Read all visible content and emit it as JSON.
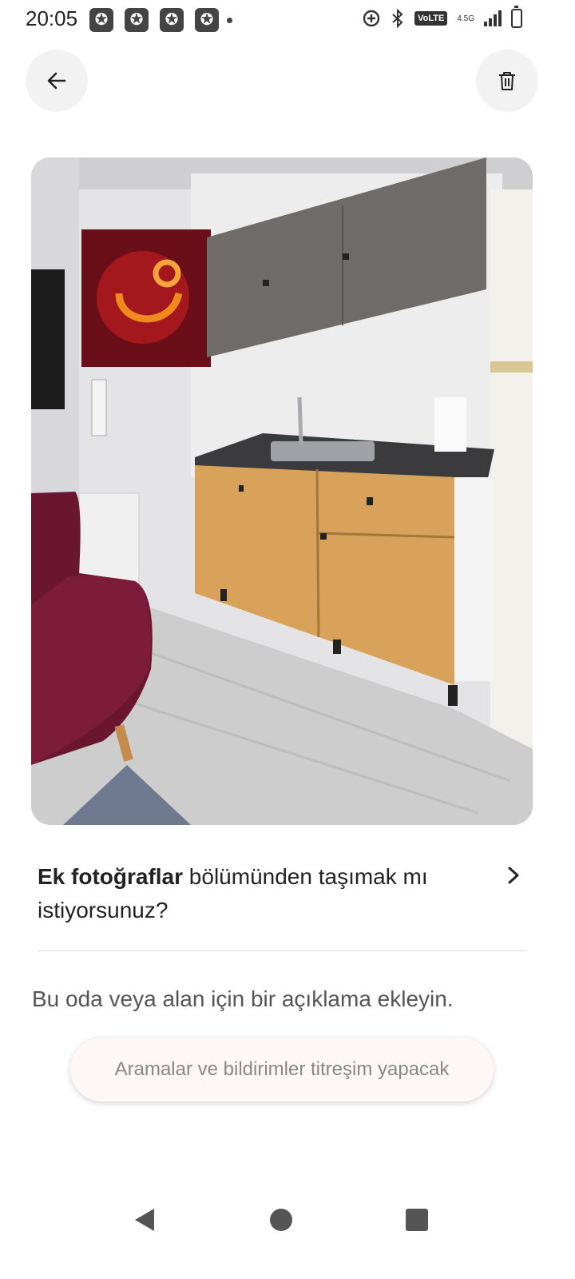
{
  "status_bar": {
    "time": "20:05",
    "notification_icons": [
      "star-badge-icon",
      "star-badge-icon",
      "star-badge-icon",
      "star-badge-icon"
    ],
    "volte": "VoLTE",
    "network": "4.5G"
  },
  "header": {
    "back_icon": "arrow-left-icon",
    "delete_icon": "trash-icon"
  },
  "move_prompt": {
    "bold": "Ek fotoğraflar",
    "rest": " bölümünden taşımak mı istiyorsunuz?"
  },
  "description_placeholder": "Bu oda veya alan için bir açıklama ekleyin.",
  "toast": "Aramalar ve bildirimler titreşim yapacak",
  "colors": {
    "background": "#ffffff",
    "button_bg": "#f2f2f2",
    "text": "#222222",
    "muted": "#555555",
    "toast_bg": "#fdf7f5"
  }
}
